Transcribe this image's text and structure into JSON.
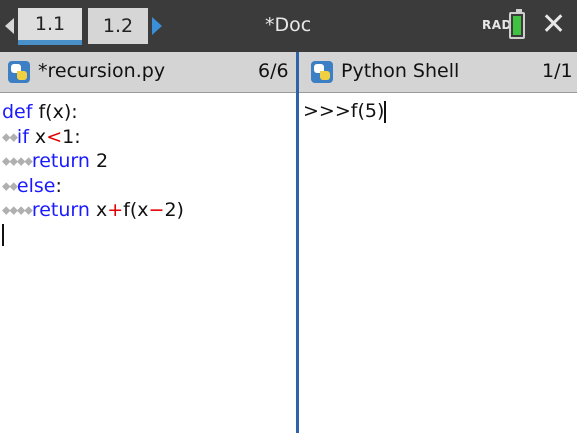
{
  "topbar": {
    "tabs": [
      {
        "label": "1.1",
        "active": true
      },
      {
        "label": "1.2",
        "active": false
      }
    ],
    "doc_title": "*Doc",
    "angle_mode": "RAD",
    "battery_color": "#3fc23f",
    "accent": "#3a8fd8"
  },
  "editor": {
    "title": "*recursion.py",
    "page": "6/6",
    "lines": [
      {
        "indent": 0,
        "tokens": [
          {
            "t": "def",
            "c": "kw"
          },
          {
            "t": " f(x):",
            "c": "plain"
          }
        ]
      },
      {
        "indent": 2,
        "tokens": [
          {
            "t": "if",
            "c": "kw"
          },
          {
            "t": " x",
            "c": "plain"
          },
          {
            "t": "<",
            "c": "op"
          },
          {
            "t": "1:",
            "c": "plain"
          }
        ]
      },
      {
        "indent": 4,
        "tokens": [
          {
            "t": "return",
            "c": "kw"
          },
          {
            "t": " 2",
            "c": "plain"
          }
        ]
      },
      {
        "indent": 2,
        "tokens": [
          {
            "t": "else",
            "c": "kw"
          },
          {
            "t": ":",
            "c": "plain"
          }
        ]
      },
      {
        "indent": 4,
        "tokens": [
          {
            "t": "return",
            "c": "kw"
          },
          {
            "t": " x",
            "c": "plain"
          },
          {
            "t": "+",
            "c": "op"
          },
          {
            "t": "f(x",
            "c": "plain"
          },
          {
            "t": "−",
            "c": "op"
          },
          {
            "t": "2)",
            "c": "plain"
          }
        ]
      }
    ]
  },
  "shell": {
    "title": "Python Shell",
    "page": "1/1",
    "prompt": ">>>",
    "input": "f(5)"
  }
}
